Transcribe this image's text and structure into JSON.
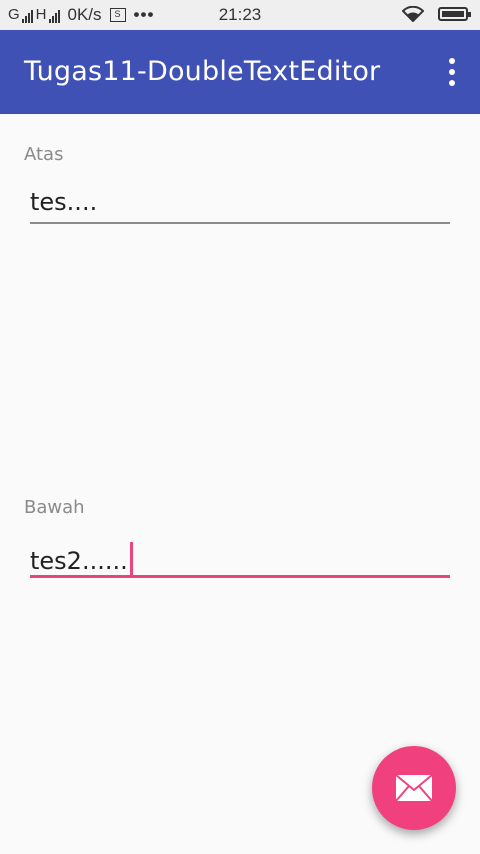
{
  "status_bar": {
    "network_label": "G",
    "network_label2": "H",
    "speed": "0K/s",
    "sim_icon_glyph": "S",
    "dots": "•••",
    "time": "21:23",
    "icons": [
      "signal-icon",
      "sim-icon",
      "more-icon",
      "wifi-icon",
      "battery-icon"
    ]
  },
  "app_bar": {
    "title": "Tugas11-DoubleTextEditor",
    "color": "#3f51b5",
    "menu_icon": "overflow-menu-icon"
  },
  "form": {
    "top": {
      "label": "Atas",
      "value": "tes...."
    },
    "bottom": {
      "label": "Bawah",
      "value": "tes2......",
      "focused": true
    }
  },
  "fab": {
    "icon": "mail-icon",
    "color": "#f0417e"
  },
  "colors": {
    "accent": "#e8457a",
    "background": "#fafafa"
  }
}
